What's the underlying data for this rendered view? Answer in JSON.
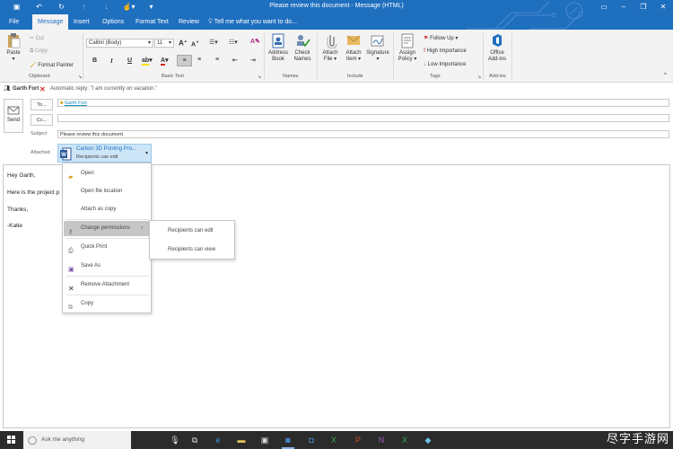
{
  "window": {
    "title": "Please review this document - Message (HTML)"
  },
  "tabs": [
    "File",
    "Message",
    "Insert",
    "Options",
    "Format Text",
    "Review"
  ],
  "tell_me": "Tell me what you want to do...",
  "ribbon": {
    "clipboard": {
      "label": "Clipboard",
      "paste": "Paste",
      "cut": "Cut",
      "copy": "Copy",
      "format_painter": "Format Painter"
    },
    "basic_text": {
      "label": "Basic Text",
      "font": "Calibri (Body)",
      "size": "11",
      "bold": "B",
      "italic": "I",
      "underline": "U"
    },
    "names": {
      "label": "Names",
      "address_book_1": "Address",
      "address_book_2": "Book",
      "check_names_1": "Check",
      "check_names_2": "Names"
    },
    "include": {
      "label": "Include",
      "attach_file_1": "Attach",
      "attach_file_2": "File",
      "attach_item_1": "Attach",
      "attach_item_2": "Item",
      "signature": "Signature"
    },
    "tags": {
      "label": "Tags",
      "assign_policy_1": "Assign",
      "assign_policy_2": "Policy",
      "follow_up": "Follow Up",
      "high_importance": "High Importance",
      "low_importance": "Low Importance"
    },
    "addins": {
      "label": "Add-ins",
      "office_addins_1": "Office",
      "office_addins_2": "Add-ins"
    }
  },
  "infobar": {
    "contact": "Garth Fort",
    "message": "Automatic reply: \"I am currently on vacation.\""
  },
  "compose": {
    "send": "Send",
    "to_button": "To...",
    "cc_button": "Cc...",
    "to_value": "Garth Fort",
    "subject_label": "Subject",
    "subject_value": "Please review this document",
    "attached_label": "Attached",
    "attachment_name": "Carbon 3D Printing Pro...",
    "attachment_sub": "Recipients can edit"
  },
  "body_lines": [
    "Hey Garth,",
    "Here is the project p",
    "Thanks,",
    "-Katie"
  ],
  "context_menu": {
    "open": "Open",
    "open_file_location": "Open file location",
    "attach_as_copy": "Attach as copy",
    "change_permissions": "Change permissions",
    "quick_print": "Quick Print",
    "save_as": "Save As",
    "remove_attachment": "Remove Attachment",
    "copy": "Copy"
  },
  "submenu": {
    "can_edit": "Recipients can edit",
    "can_view": "Recipients can view"
  },
  "taskbar": {
    "search_placeholder": "Ask me anything",
    "watermark": "尽字手游网"
  },
  "colors": {
    "accent": "#1f6fbf",
    "ribbon_bg": "#f3f3f3",
    "taskbar": "#2b2b2b",
    "highlight": "#c6c6c6"
  }
}
